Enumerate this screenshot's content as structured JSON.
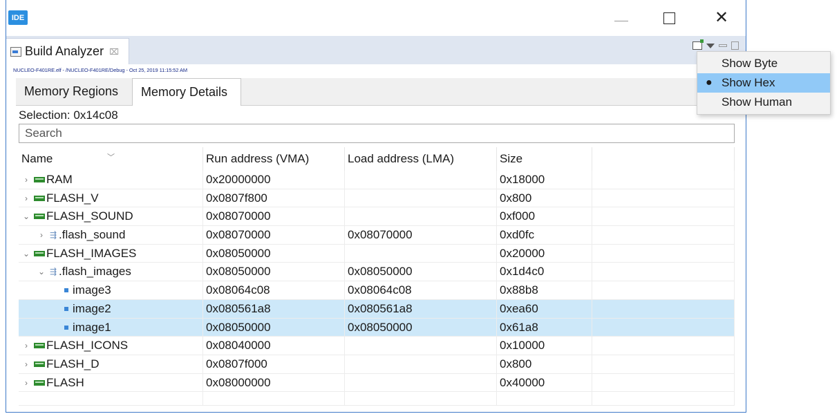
{
  "titlebar": {
    "logo": "IDE",
    "minimize": "—",
    "maximize": "",
    "close": "✕"
  },
  "view": {
    "tab_label": "Build Analyzer",
    "tab_close": "⌧",
    "path": "NUCLEO-F401RE.elf - /NUCLEO-F401RE/Debug - Oct 25, 2019 11:15:52 AM"
  },
  "tabs": [
    {
      "label": "Memory Regions",
      "active": false
    },
    {
      "label": "Memory Details",
      "active": true
    }
  ],
  "selection_text": "Selection: 0x14c08",
  "search": {
    "placeholder": "Search"
  },
  "table": {
    "columns": [
      "Name",
      "Run address (VMA)",
      "Load address (LMA)",
      "Size"
    ],
    "rows": [
      {
        "name": "RAM",
        "vma": "0x20000000",
        "lma": "",
        "size": "0x18000",
        "level": 0,
        "expander": "›",
        "icon": "memory-region-icon",
        "selected": false
      },
      {
        "name": "FLASH_V",
        "vma": "0x0807f800",
        "lma": "",
        "size": "0x800",
        "level": 0,
        "expander": "›",
        "icon": "memory-region-icon",
        "selected": false
      },
      {
        "name": "FLASH_SOUND",
        "vma": "0x08070000",
        "lma": "",
        "size": "0xf000",
        "level": 0,
        "expander": "⌄",
        "icon": "memory-region-icon",
        "selected": false
      },
      {
        "name": ".flash_sound",
        "vma": "0x08070000",
        "lma": "0x08070000",
        "size": "0xd0fc",
        "level": 1,
        "expander": "›",
        "icon": "section-icon",
        "selected": false
      },
      {
        "name": "FLASH_IMAGES",
        "vma": "0x08050000",
        "lma": "",
        "size": "0x20000",
        "level": 0,
        "expander": "⌄",
        "icon": "memory-region-icon",
        "selected": false
      },
      {
        "name": ".flash_images",
        "vma": "0x08050000",
        "lma": "0x08050000",
        "size": "0x1d4c0",
        "level": 1,
        "expander": "⌄",
        "icon": "section-icon",
        "selected": false
      },
      {
        "name": "image3",
        "vma": "0x08064c08",
        "lma": "0x08064c08",
        "size": "0x88b8",
        "level": 2,
        "expander": "",
        "icon": "symbol-icon",
        "selected": false
      },
      {
        "name": "image2",
        "vma": "0x080561a8",
        "lma": "0x080561a8",
        "size": "0xea60",
        "level": 2,
        "expander": "",
        "icon": "symbol-icon",
        "selected": true
      },
      {
        "name": "image1",
        "vma": "0x08050000",
        "lma": "0x08050000",
        "size": "0x61a8",
        "level": 2,
        "expander": "",
        "icon": "symbol-icon",
        "selected": true
      },
      {
        "name": "FLASH_ICONS",
        "vma": "0x08040000",
        "lma": "",
        "size": "0x10000",
        "level": 0,
        "expander": "›",
        "icon": "memory-region-icon",
        "selected": false
      },
      {
        "name": "FLASH_D",
        "vma": "0x0807f000",
        "lma": "",
        "size": "0x800",
        "level": 0,
        "expander": "›",
        "icon": "memory-region-icon",
        "selected": false
      },
      {
        "name": "FLASH",
        "vma": "0x08000000",
        "lma": "",
        "size": "0x40000",
        "level": 0,
        "expander": "›",
        "icon": "memory-region-icon",
        "selected": false
      }
    ]
  },
  "dropdown_menu": {
    "items": [
      {
        "label": "Show Byte",
        "checked": false
      },
      {
        "label": "Show Hex",
        "checked": true
      },
      {
        "label": "Show Human",
        "checked": false
      }
    ]
  },
  "colors": {
    "accent": "#3c78c8",
    "selection": "#cde8f9",
    "menu_highlight": "#91c9f7"
  }
}
